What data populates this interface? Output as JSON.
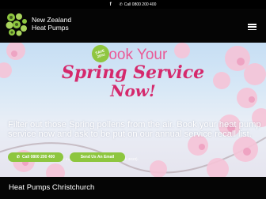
{
  "topbar": {
    "social_icon": "facebook-icon",
    "phone_icon": "phone-icon",
    "phone_text": "Call 0800 200 400"
  },
  "header": {
    "brand_line1": "New Zealand",
    "brand_line2": "Heat Pumps",
    "menu_icon": "hamburger-menu-icon"
  },
  "hero": {
    "title_line1": "Book Your",
    "title_line2": "Spring Service",
    "title_line3": "Now!",
    "badge_line1": "SAVE",
    "badge_line2": "20%!",
    "description": "Filter out those Spring pollens from the air. Book your heat pump service now and ask to be put on our annual service recall list.",
    "note": "* Valid until end of November (work must be completed by November 30th 2023).",
    "call_button": "Call 0800 200 400",
    "email_button": "Send Us An Email"
  },
  "footer": {
    "heading": "Heat Pumps Christchurch"
  },
  "colors": {
    "accent_green": "#8dc63f",
    "title_pink": "#d5296c",
    "dark": "#050505"
  }
}
